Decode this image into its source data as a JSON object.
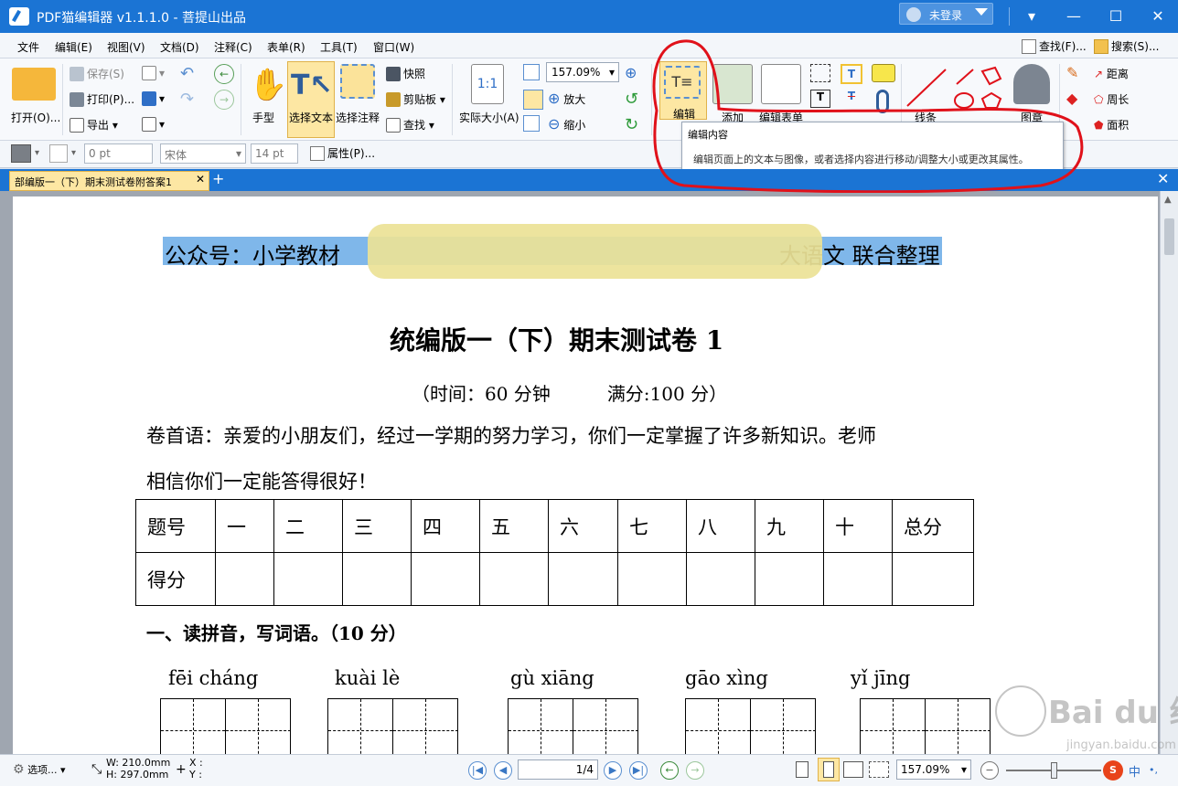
{
  "window": {
    "title": "PDF猫编辑器 v1.1.1.0 - 菩提山出品",
    "login_label": "未登录",
    "controls": [
      "▾",
      "—",
      "☐",
      "✕"
    ]
  },
  "menu": {
    "items": [
      "文件",
      "编辑(E)",
      "视图(V)",
      "文档(D)",
      "注释(C)",
      "表单(R)",
      "工具(T)",
      "窗口(W)"
    ],
    "find": "查找(F)...",
    "search": "搜索(S)..."
  },
  "ribbon": {
    "open": "打开(O)...",
    "save": "保存(S)",
    "print": "打印(P)...",
    "export": "导出",
    "hand": "手型",
    "select_text": "选择文本",
    "select_annot": "选择注释",
    "snapshot": "快照",
    "clipboard": "剪贴板",
    "find": "查找",
    "actual_size": "实际大小(A)",
    "zoom_value": "157.09%",
    "zoom_in": "放大",
    "zoom_out": "缩小",
    "edit": "编辑",
    "add": "添加",
    "edit_form": "编辑表单",
    "line": "线条",
    "stamp": "图章",
    "distance": "距离",
    "perimeter": "周长",
    "area": "面积"
  },
  "propbar": {
    "line_width": "0 pt",
    "font": "宋体",
    "font_size": "14 pt",
    "properties": "属性(P)..."
  },
  "tooltip": {
    "title": "编辑内容",
    "description": "编辑页面上的文本与图像，或者选择内容进行移动/调整大小或更改其属性。"
  },
  "tab": {
    "name": "部编版一（下）期末测试卷附答案1"
  },
  "document": {
    "header_left": "公众号：小学教材",
    "header_right": "大语文 联合整理",
    "title": "统编版一（下）期末测试卷 1",
    "time": "（时间：60 分钟",
    "full_score": "满分:100 分）",
    "preface_1": "卷首语：亲爱的小朋友们，经过一学期的努力学习，你们一定掌握了许多新知识。老师",
    "preface_2": "相信你们一定能答得很好！",
    "table": {
      "row1": [
        "题号",
        "一",
        "二",
        "三",
        "四",
        "五",
        "六",
        "七",
        "八",
        "九",
        "十",
        "总分"
      ],
      "row2": [
        "得分",
        "",
        "",
        "",
        "",
        "",
        "",
        "",
        "",
        "",
        "",
        ""
      ]
    },
    "section1": "一、读拼音，写词语。（10 分）",
    "pinyin": [
      "fēi cháng",
      "kuài lè",
      "gù xiāng",
      "gāo xìng",
      "yǐ jīng"
    ]
  },
  "statusbar": {
    "options": "选项...",
    "width": "W: 210.0mm",
    "height": "H: 297.0mm",
    "x": "X :",
    "y": "Y :",
    "page": "1/4",
    "zoom": "157.09%"
  },
  "watermark": {
    "brand": "Bai du 经验",
    "url": "jingyan.baidu.com"
  },
  "colors": {
    "titlebar": "#1b74d4",
    "highlight": "#7fb7ea",
    "active_tool": "#fde7a3",
    "annotation_red": "#e0111a"
  }
}
